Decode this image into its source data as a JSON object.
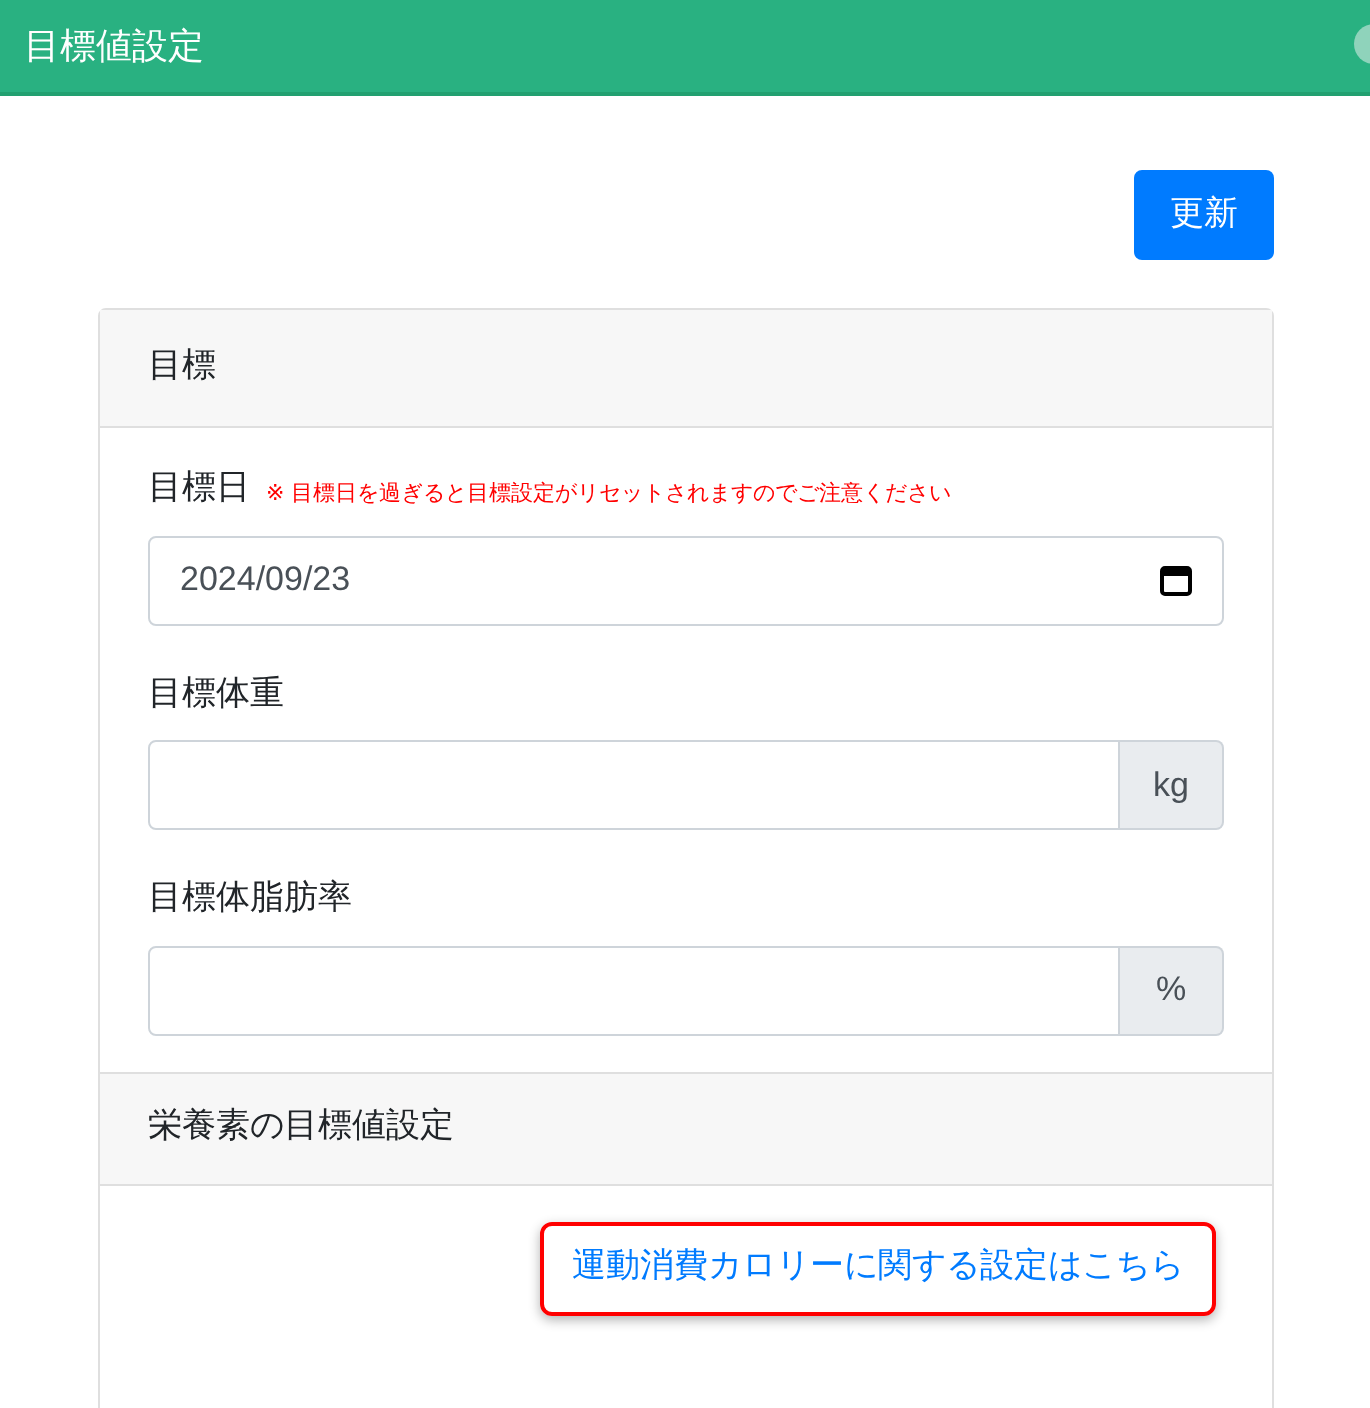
{
  "header": {
    "title": "目標値設定"
  },
  "update_button": {
    "label": "更新"
  },
  "card": {
    "title": "目標",
    "fields": [
      {
        "kind": "date",
        "label": "目標日",
        "note": "※ 目標日を過ぎると目標設定がリセットされますのでご注意ください",
        "value": "2024/09/23"
      },
      {
        "kind": "addon",
        "label": "目標体重",
        "addon": "kg"
      },
      {
        "kind": "addon",
        "label": "目標体脂肪率",
        "addon": "%"
      }
    ],
    "section_title": "栄養素の目標値設定",
    "link": {
      "label": "運動消費カロリーに関する設定はこちら",
      "highlighted": true
    }
  }
}
